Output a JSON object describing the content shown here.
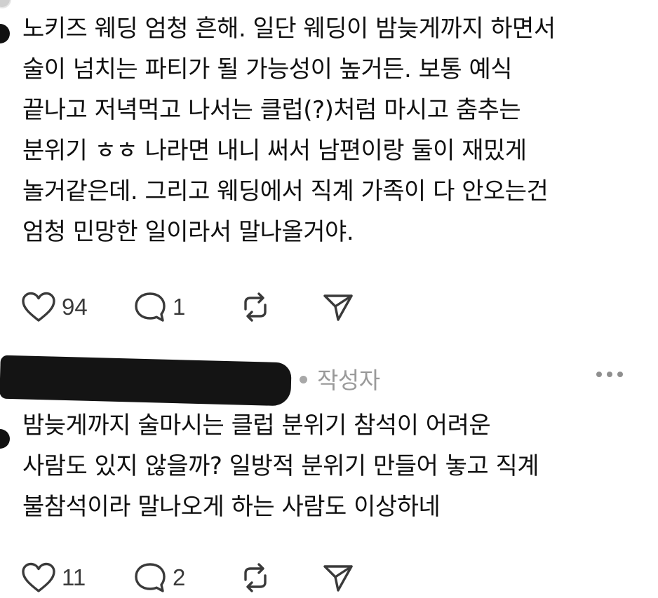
{
  "post1": {
    "text": "노키즈 웨딩 엄청 흔해. 일단 웨딩이 밤늦게까지 하면서\n술이 넘치는 파티가 될 가능성이 높거든. 보통 예식\n끝나고 저녁먹고 나서는 클럽(?)처럼 마시고 춤추는\n분위기 ㅎㅎ 나라면 내니 써서 남편이랑 둘이 재밌게\n놀거같은데. 그리고 웨딩에서 직계 가족이 다 안오는건\n엄청 민망한 일이라서 말나올거야.",
    "likes": "94",
    "comments": "1"
  },
  "post2": {
    "author_tag": "작성자",
    "text": "밤늦게까지 술마시는 클럽 분위기 참석이 어려운\n사람도 있지 않을까? 일방적 분위기 만들어 놓고 직계\n불참석이라 말나오게 하는 사람도 이상하네",
    "likes": "11",
    "comments": "2"
  },
  "icons": {
    "like": "heart-icon",
    "comment": "comment-bubble-icon",
    "repost": "repost-icon",
    "share": "send-icon",
    "more": "more-dots-icon"
  },
  "colors": {
    "text": "#101010",
    "muted": "#9a9a9a",
    "icon": "#3a3a3a"
  }
}
